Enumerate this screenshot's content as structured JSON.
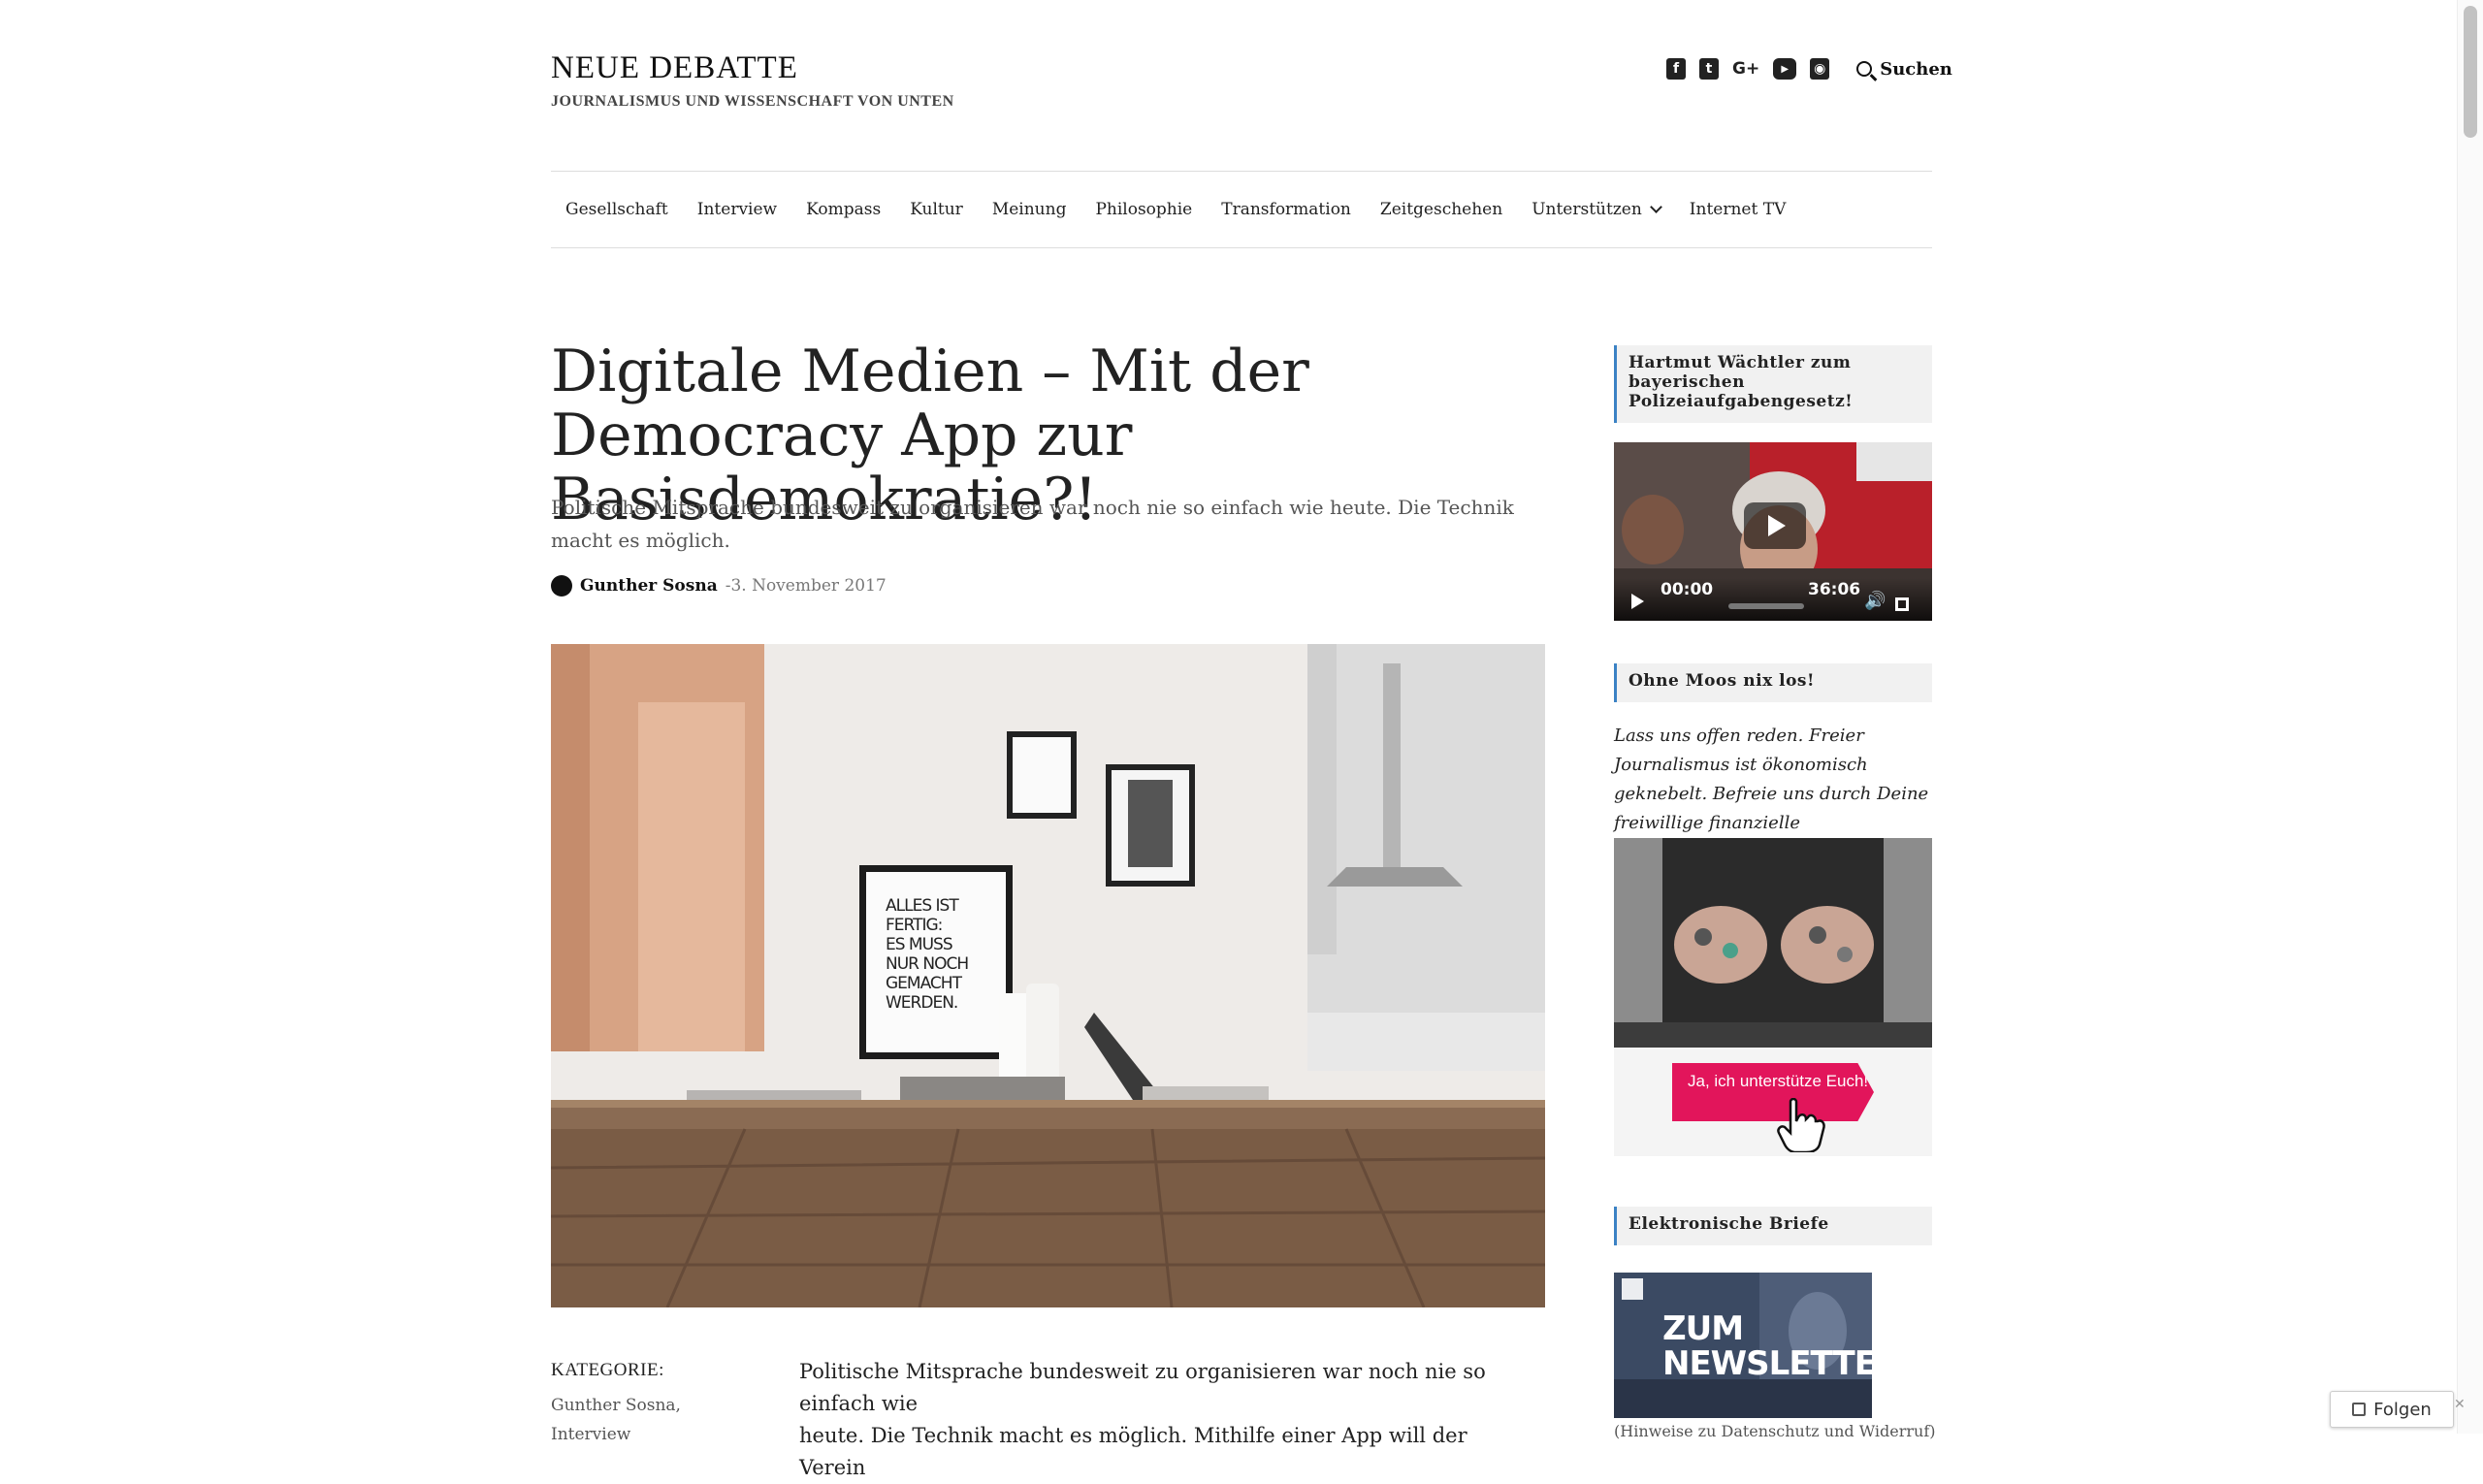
{
  "site": {
    "title": "NEUE DEBATTE",
    "description": "JOURNALISMUS UND WISSENSCHAFT VON UNTEN",
    "search_label": "Suchen"
  },
  "social": [
    {
      "name": "facebook-icon",
      "glyph": "f"
    },
    {
      "name": "twitter-icon",
      "glyph": "t"
    },
    {
      "name": "google-plus-icon",
      "glyph": "G+"
    },
    {
      "name": "youtube-icon",
      "glyph": "▶"
    },
    {
      "name": "rss-icon",
      "glyph": "◉"
    }
  ],
  "nav": {
    "items": [
      "Gesellschaft",
      "Interview",
      "Kompass",
      "Kultur",
      "Meinung",
      "Philosophie",
      "Transformation",
      "Zeitgeschehen",
      "Unterstützen",
      "Internet TV"
    ]
  },
  "article": {
    "title": "Digitale Medien – Mit der Democracy App zur Basisdemokratie?!",
    "subtitle": "Politische Mitsprache bundesweit zu organisieren war noch nie so einfach wie heute. Die Technik macht es möglich.",
    "author": "Gunther Sosna",
    "date": "3. November 2017",
    "date_sep": " - ",
    "poster_lines": [
      "ALLES IST",
      "FERTIG:",
      "ES MUSS",
      "NUR NOCH",
      "GEMACHT",
      "WERDEN."
    ],
    "kategorie_label": "KATEGORIE:",
    "kategorie_links": [
      "Gunther Sosna,",
      "Interview"
    ],
    "body_lines": [
      "Politische Mitsprache bundesweit zu organisieren war noch nie so einfach wie",
      "heute. Die Technik macht es möglich. Mithilfe einer App will der Verein"
    ]
  },
  "sidebar": {
    "video_widget_title": "Hartmut Wächtler zum bayerischen Polizeiaufgabengesetz!",
    "video_current": "00:00",
    "video_duration": "36:06",
    "support_widget_title": "Ohne Moos nix los!",
    "support_text": "Lass uns offen reden. Freier Journalismus ist ökonomisch geknebelt. Befreie uns durch Deine freiwillige finanzielle Unterstützung.",
    "support_cta": "Ja, ich unterstütze Euch!",
    "newsletter_widget_title": "Elektronische Briefe",
    "newsletter_text": "ZUM NEWSLETTER",
    "under_newsletter": "(Hinweise zu Datenschutz und Widerruf)"
  },
  "follow": {
    "label": "Folgen"
  },
  "colors": {
    "accent": "#3b82c4",
    "cta": "#e2155b"
  }
}
